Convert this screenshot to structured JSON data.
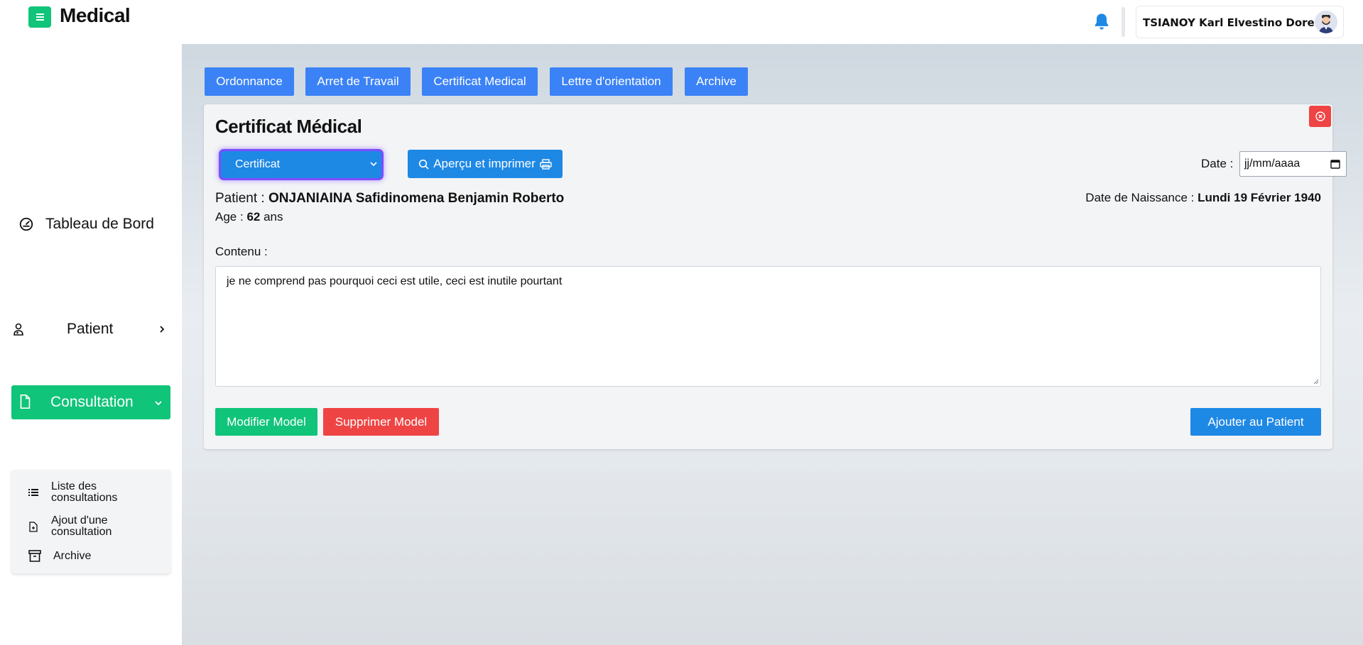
{
  "header": {
    "app_title": "Medical",
    "user_name": "TSIANOY Karl Elvestino Dorelin",
    "accent_color": "#10c47a",
    "icons": {
      "menu": "menu-icon",
      "bell": "bell-icon",
      "avatar": "user-avatar"
    }
  },
  "sidebar": {
    "items": [
      {
        "label": "Tableau de Bord",
        "icon": "dashboard-gauge-icon"
      },
      {
        "label": "Patient",
        "icon": "patient-icon"
      },
      {
        "label": "Consultation",
        "icon": "document-icon",
        "active": true
      }
    ],
    "submenu": [
      {
        "label_line1": "Liste des",
        "label_line2": "consultations",
        "icon": "list-icon"
      },
      {
        "label_line1": "Ajout d'une",
        "label_line2": "consultation",
        "icon": "file-add-icon"
      },
      {
        "label_line1": "Archive",
        "label_line2": "",
        "icon": "archive-icon"
      }
    ]
  },
  "tabs": [
    {
      "label": "Ordonnance"
    },
    {
      "label": "Arret de Travail"
    },
    {
      "label": "Certificat Medical"
    },
    {
      "label": "Lettre d'orientation"
    },
    {
      "label": "Archive"
    }
  ],
  "card": {
    "title": "Certificat Médical",
    "model_select_value": "Certificat",
    "preview_label": "Aperçu et imprimer",
    "date_label": "Date :",
    "date_placeholder": "jj/mm/aaaa",
    "patient_label": "Patient :",
    "patient_name": "ONJANIAINA Safidinomena Benjamin Roberto",
    "age_label": "Age :",
    "age_value": "62",
    "age_unit": "ans",
    "dob_label": "Date de Naissance :",
    "dob_value": "Lundi 19 Février 1940",
    "content_label": "Contenu :",
    "content_text": "je ne comprend pas pourquoi ceci est utile, ceci est inutile pourtant",
    "edit_model_label": "Modifier Model",
    "delete_model_label": "Supprimer Model",
    "add_patient_label": "Ajouter au Patient"
  },
  "colors": {
    "green": "#10c47a",
    "red": "#ef4444",
    "blue": "#1e88e5",
    "tab_blue": "#3b82f6"
  }
}
